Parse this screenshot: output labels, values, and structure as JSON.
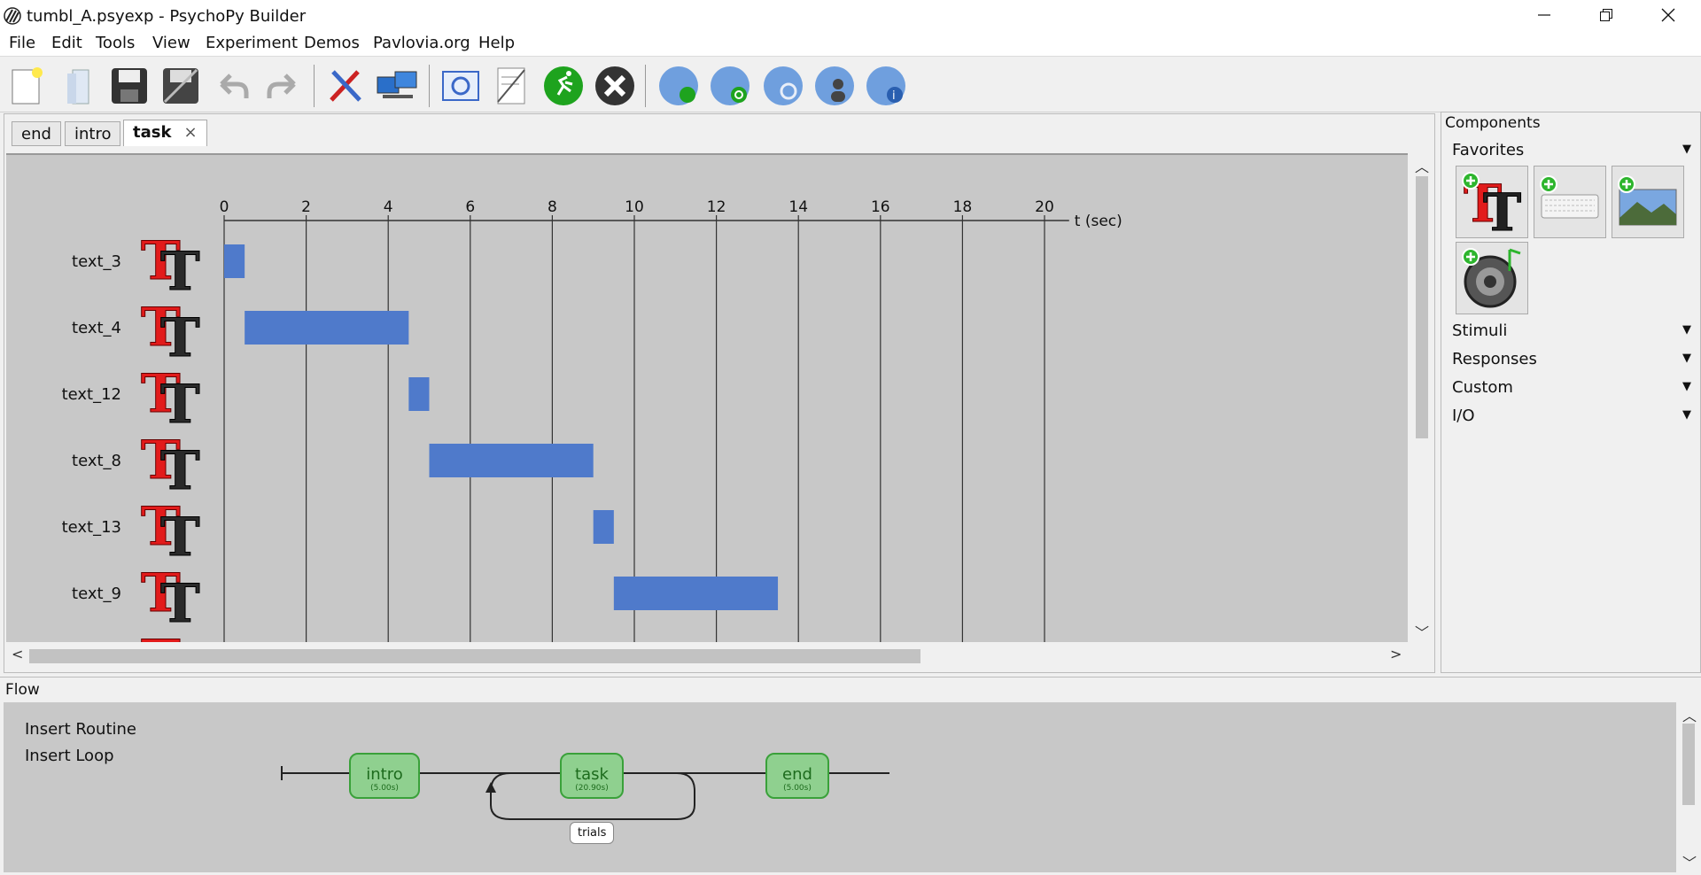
{
  "window": {
    "title": "tumbl_A.psyexp - PsychoPy Builder",
    "controls": [
      "minimize",
      "restore",
      "close"
    ]
  },
  "menu": [
    "File",
    "Edit",
    "Tools",
    "View",
    "Experiment",
    "Demos",
    "Pavlovia.org",
    "Help"
  ],
  "toolbar": {
    "buttons": [
      "new-file",
      "open-file",
      "save",
      "save-as",
      "undo",
      "redo",
      "preferences",
      "monitor-center",
      "experiment-settings",
      "compile-script",
      "run",
      "stop",
      "pavlovia-sync",
      "pavlovia-search",
      "pavlovia-user",
      "pavlovia-project-info"
    ]
  },
  "routine_tabs": [
    {
      "label": "end",
      "active": false
    },
    {
      "label": "intro",
      "active": false
    },
    {
      "label": "task",
      "active": true,
      "close": "×"
    }
  ],
  "timeline": {
    "axis_unit": "t (sec)",
    "ticks": [
      "0",
      "2",
      "4",
      "6",
      "8",
      "10",
      "12",
      "14",
      "16",
      "18",
      "20"
    ],
    "components": [
      {
        "name": "text_3",
        "start": 0.0,
        "stop": 0.5
      },
      {
        "name": "text_4",
        "start": 0.5,
        "stop": 4.5
      },
      {
        "name": "text_12",
        "start": 4.5,
        "stop": 5.0
      },
      {
        "name": "text_8",
        "start": 5.0,
        "stop": 9.0
      },
      {
        "name": "text_13",
        "start": 9.0,
        "stop": 9.5
      },
      {
        "name": "text_9",
        "start": 9.5,
        "stop": 13.5
      }
    ],
    "colors": {
      "bar": "#4f7acb",
      "canvas": "#c8c8c8"
    }
  },
  "components_panel": {
    "title": "Components",
    "favorites_label": "Favorites",
    "favorites": [
      "text-component",
      "keyboard-component",
      "image-component",
      "sound-component"
    ],
    "categories": [
      "Stimuli",
      "Responses",
      "Custom",
      "I/O"
    ]
  },
  "flow": {
    "title": "Flow",
    "insert_routine": "Insert Routine",
    "insert_loop": "Insert Loop",
    "routines": [
      {
        "name": "intro",
        "duration": "(5.00s)"
      },
      {
        "name": "task",
        "duration": "(20.90s)"
      },
      {
        "name": "end",
        "duration": "(5.00s)"
      }
    ],
    "loop": "trials",
    "colors": {
      "routine_fill": "#8fd08f",
      "routine_border": "#3aa13a"
    }
  }
}
